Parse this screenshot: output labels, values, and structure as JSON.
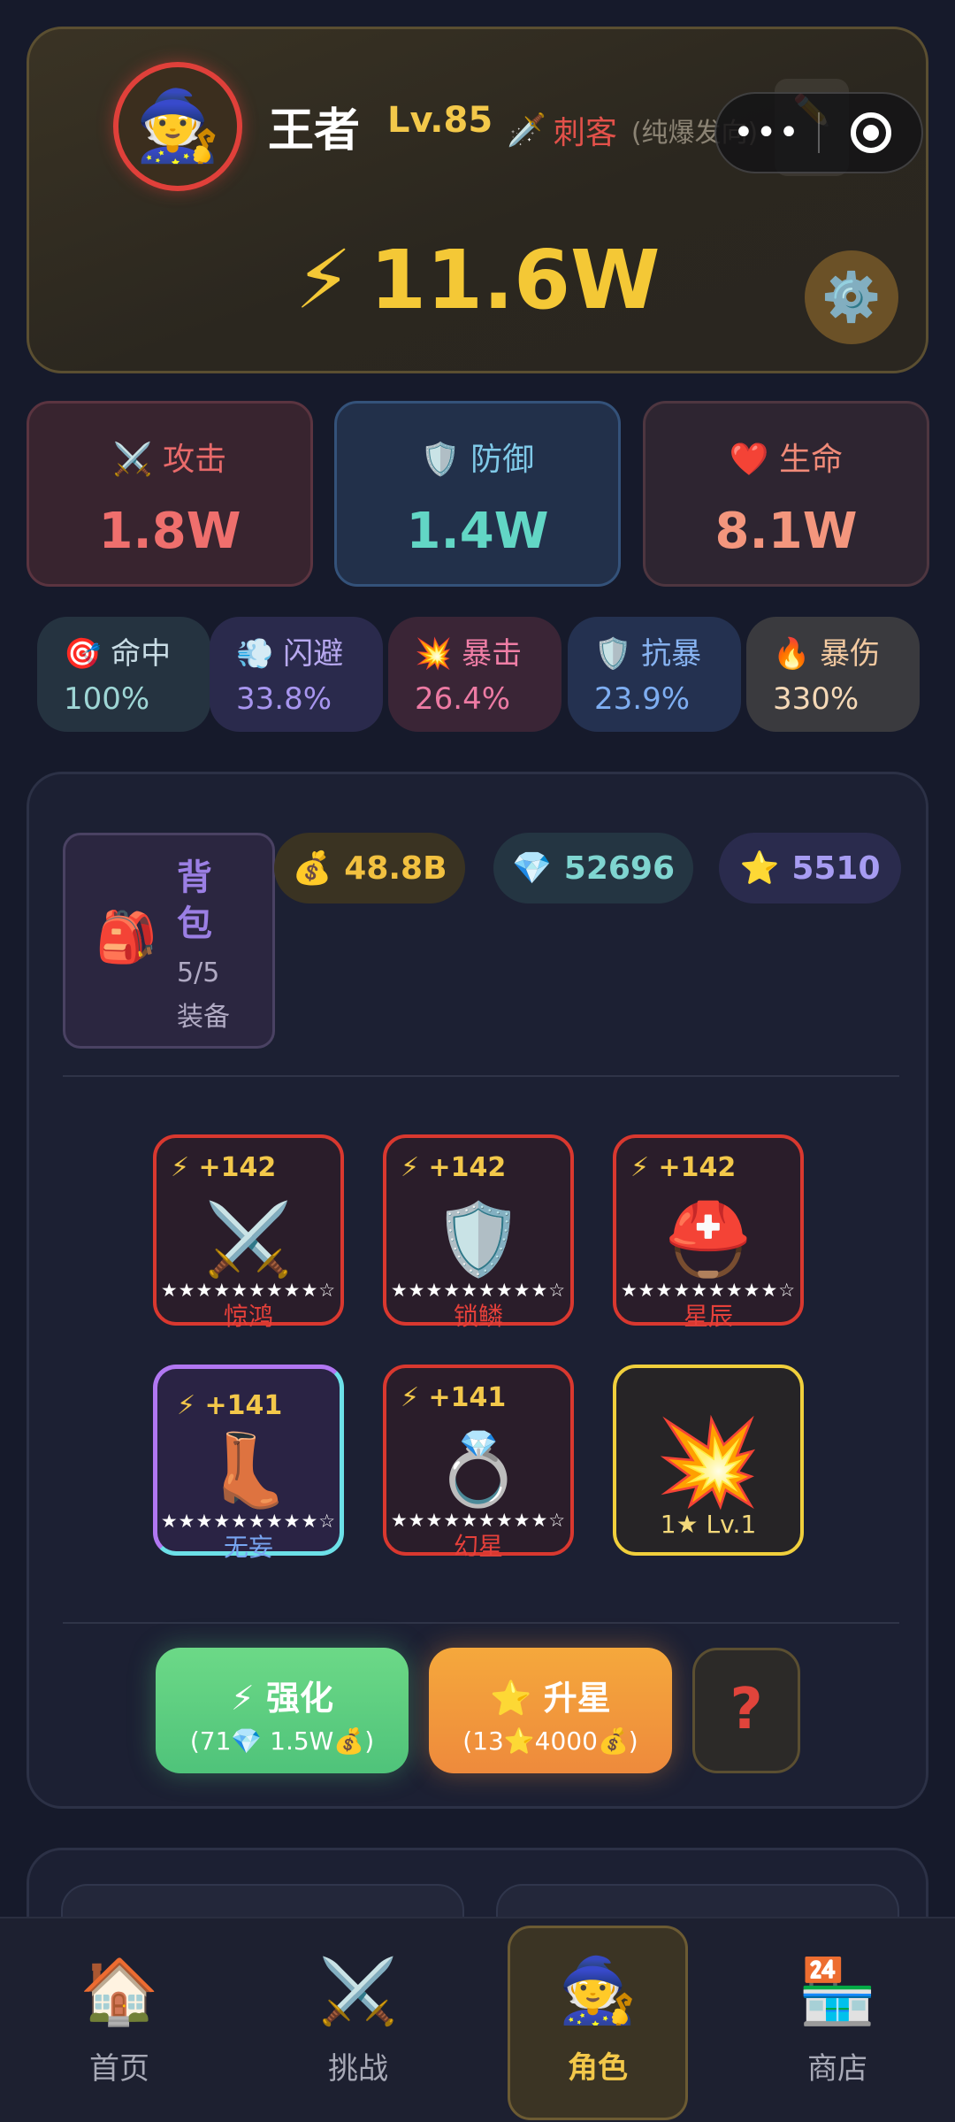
{
  "profile": {
    "avatar_icon": "🧙",
    "name": "王者",
    "level": "Lv.85",
    "class_icon": "🗡️",
    "class_name": "刺客",
    "class_sub": "(纯爆发向)",
    "edit_icon": "✏️",
    "power_icon": "⚡",
    "power": "11.6W",
    "settings_icon": "⚙️"
  },
  "capsule": {
    "more": "•••",
    "close": "target"
  },
  "main_stats": [
    {
      "icon": "⚔️",
      "label": "攻击",
      "value": "1.8W"
    },
    {
      "icon": "🛡️",
      "label": "防御",
      "value": "1.4W"
    },
    {
      "icon": "❤️",
      "label": "生命",
      "value": "8.1W"
    }
  ],
  "sub_stats": [
    {
      "icon": "🎯",
      "label": "命中",
      "value": "100%"
    },
    {
      "icon": "💨",
      "label": "闪避",
      "value": "33.8%"
    },
    {
      "icon": "💥",
      "label": "暴击",
      "value": "26.4%"
    },
    {
      "icon": "🛡️",
      "label": "抗暴",
      "value": "23.9%"
    },
    {
      "icon": "🔥",
      "label": "暴伤",
      "value": "330%"
    }
  ],
  "bag": {
    "icon": "🎒",
    "title": "背包",
    "count": "5/5",
    "unit": "装备"
  },
  "resources": [
    {
      "icon": "💰",
      "value": "48.8B"
    },
    {
      "icon": "💎",
      "value": "52696"
    },
    {
      "icon": "⭐",
      "value": "5510"
    }
  ],
  "equipment": [
    {
      "power": "⚡ +142",
      "icon": "⚔️",
      "stars": "★★★★★★★★★☆",
      "name": "惊鸿"
    },
    {
      "power": "⚡ +142",
      "icon": "🛡️",
      "stars": "★★★★★★★★★☆",
      "name": "锁鳞"
    },
    {
      "power": "⚡ +142",
      "icon": "⛑️",
      "stars": "★★★★★★★★★☆",
      "name": "星辰"
    },
    {
      "power": "⚡ +141",
      "icon": "👢",
      "stars": "★★★★★★★★★☆",
      "name": "无妄"
    },
    {
      "power": "⚡ +141",
      "icon": "💍",
      "stars": "★★★★★★★★★☆",
      "name": "幻星"
    },
    {
      "icon": "💥",
      "level": "1★ Lv.1"
    }
  ],
  "actions": {
    "enhance_label": "⚡ 强化",
    "enhance_cost": "(71💎 1.5W💰)",
    "star_label": "⭐ 升星",
    "star_cost": "(13⭐4000💰)",
    "help": "?"
  },
  "tabs": [
    {
      "icon": "🏠",
      "label": "首页"
    },
    {
      "icon": "⚔️",
      "label": "挑战"
    },
    {
      "icon": "🧙",
      "label": "角色"
    },
    {
      "icon": "🏪",
      "label": "商店"
    }
  ],
  "colors": {
    "accent_gold": "#f3c84a",
    "attack_red": "#ef6f6d",
    "defense_teal": "#62d6c5",
    "life_salmon": "#f3967d"
  }
}
